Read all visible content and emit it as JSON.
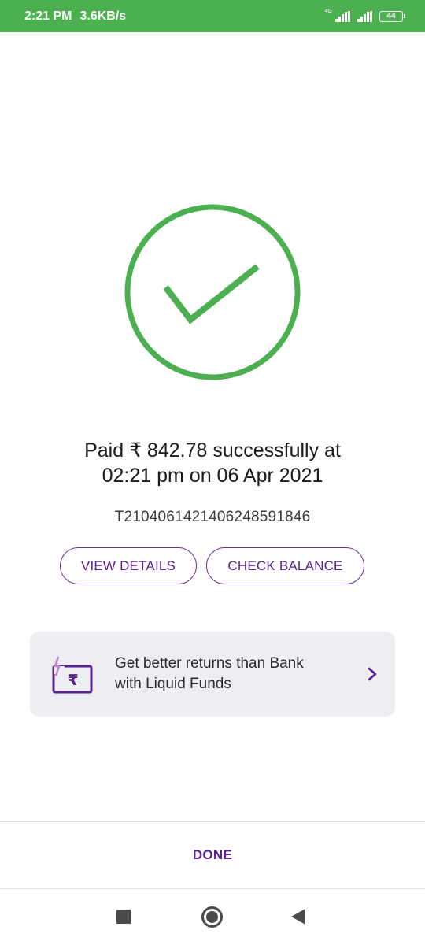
{
  "status_bar": {
    "time": "2:21 PM",
    "speed": "3.6KB/s",
    "network": "4G",
    "battery": "44"
  },
  "payment": {
    "line1": "Paid ₹ 842.78 successfully at",
    "line2": "02:21 pm on 06 Apr 2021",
    "transaction_id": "T2104061421406248591846"
  },
  "actions": {
    "view_details": "VIEW DETAILS",
    "check_balance": "CHECK BALANCE"
  },
  "promo": {
    "line1": "Get better returns than Bank",
    "line2": "with Liquid Funds",
    "icon": "rupee-bolt-icon"
  },
  "footer": {
    "done": "DONE"
  },
  "colors": {
    "status_bar": "#4caf50",
    "success_green": "#4caf50",
    "accent_purple": "#5b2190",
    "promo_bg": "#eceef1"
  }
}
